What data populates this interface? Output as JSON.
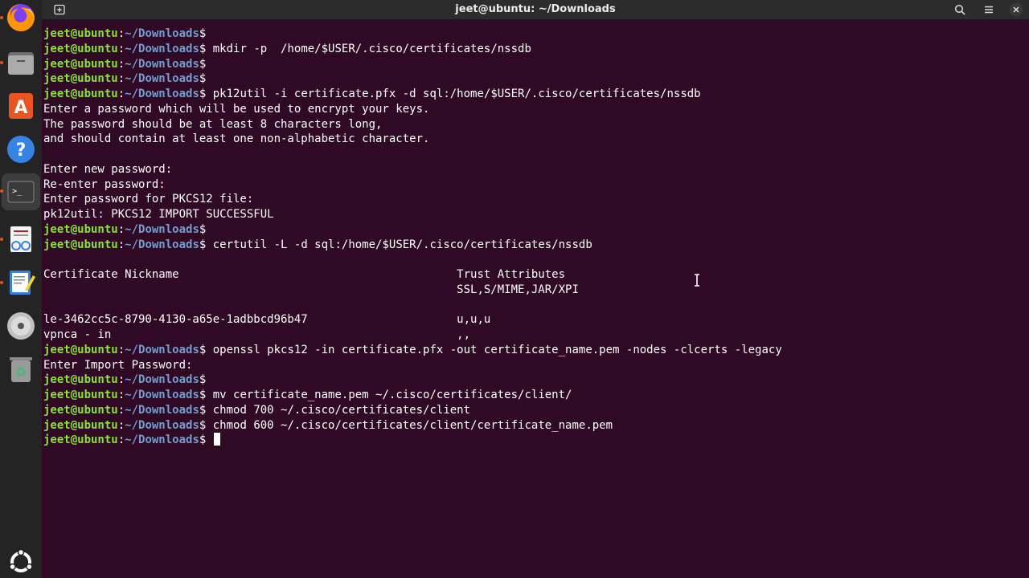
{
  "window": {
    "title": "jeet@ubuntu: ~/Downloads"
  },
  "dock": {
    "items": [
      {
        "name": "firefox",
        "icon": "firefox-icon"
      },
      {
        "name": "files",
        "icon": "files-icon"
      },
      {
        "name": "app-center",
        "icon": "app-center-icon"
      },
      {
        "name": "help",
        "icon": "help-icon"
      },
      {
        "name": "terminal",
        "icon": "terminal-icon",
        "active": true
      },
      {
        "name": "document-viewer",
        "icon": "document-viewer-icon"
      },
      {
        "name": "text-editor",
        "icon": "text-editor-icon"
      },
      {
        "name": "disc",
        "icon": "disc-icon"
      },
      {
        "name": "trash",
        "icon": "trash-icon"
      },
      {
        "name": "show-apps",
        "icon": "ubuntu-logo-icon"
      }
    ]
  },
  "prompt": {
    "user": "jeet@ubuntu",
    "colon": ":",
    "path": "~/Downloads",
    "dollar": "$"
  },
  "terminal": {
    "lines": [
      {
        "type": "prompt",
        "cmd": ""
      },
      {
        "type": "prompt",
        "cmd": " mkdir -p  /home/$USER/.cisco/certificates/nssdb"
      },
      {
        "type": "prompt",
        "cmd": ""
      },
      {
        "type": "prompt",
        "cmd": ""
      },
      {
        "type": "prompt",
        "cmd": " pk12util -i certificate.pfx -d sql:/home/$USER/.cisco/certificates/nssdb"
      },
      {
        "type": "out",
        "text": "Enter a password which will be used to encrypt your keys."
      },
      {
        "type": "out",
        "text": "The password should be at least 8 characters long,"
      },
      {
        "type": "out",
        "text": "and should contain at least one non-alphabetic character."
      },
      {
        "type": "out",
        "text": ""
      },
      {
        "type": "out",
        "text": "Enter new password:"
      },
      {
        "type": "out",
        "text": "Re-enter password:"
      },
      {
        "type": "out",
        "text": "Enter password for PKCS12 file:"
      },
      {
        "type": "out",
        "text": "pk12util: PKCS12 IMPORT SUCCESSFUL"
      },
      {
        "type": "prompt",
        "cmd": ""
      },
      {
        "type": "prompt",
        "cmd": " certutil -L -d sql:/home/$USER/.cisco/certificates/nssdb"
      },
      {
        "type": "out",
        "text": ""
      },
      {
        "type": "out",
        "text": "Certificate Nickname                                         Trust Attributes"
      },
      {
        "type": "out",
        "text": "                                                             SSL,S/MIME,JAR/XPI"
      },
      {
        "type": "out",
        "text": ""
      },
      {
        "type": "out",
        "text": "le-3462cc5c-8790-4130-a65e-1adbbcd96b47                      u,u,u"
      },
      {
        "type": "out",
        "text": "vpnca - in                                                   ,,"
      },
      {
        "type": "prompt",
        "cmd": " openssl pkcs12 -in certificate.pfx -out certificate_name.pem -nodes -clcerts -legacy"
      },
      {
        "type": "out",
        "text": "Enter Import Password:"
      },
      {
        "type": "prompt",
        "cmd": ""
      },
      {
        "type": "prompt",
        "cmd": " mv certificate_name.pem ~/.cisco/certificates/client/"
      },
      {
        "type": "prompt",
        "cmd": " chmod 700 ~/.cisco/certificates/client"
      },
      {
        "type": "prompt",
        "cmd": " chmod 600 ~/.cisco/certificates/client/certificate_name.pem"
      },
      {
        "type": "prompt",
        "cmd": " ",
        "cursor": true
      }
    ]
  },
  "colors": {
    "terminal_bg": "#300a24",
    "prompt_user": "#8ae234",
    "prompt_path": "#729fcf",
    "accent": "#e95420"
  }
}
